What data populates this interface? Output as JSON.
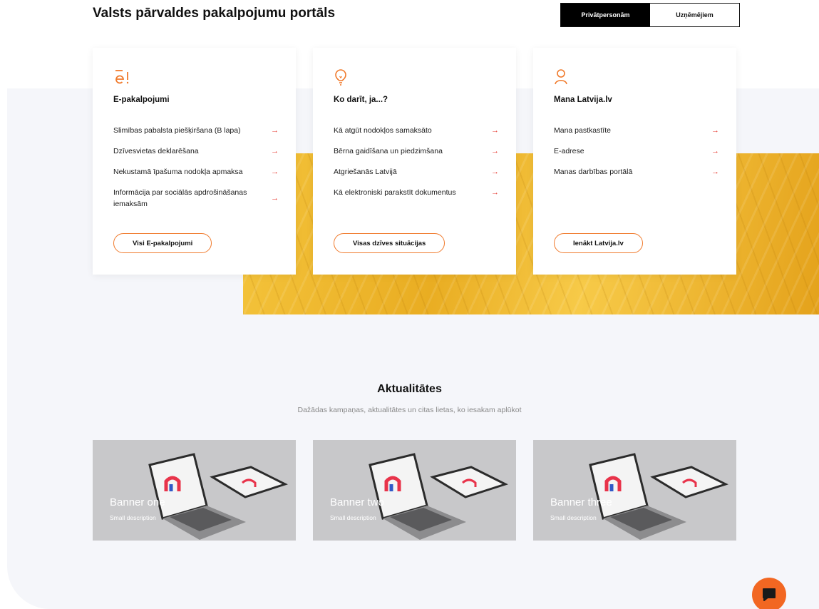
{
  "header": {
    "title": "Valsts pārvaldes pakalpojumu portāls",
    "audience_tabs": [
      {
        "label": "Privātpersonām",
        "active": true
      },
      {
        "label": "Uzņēmējiem",
        "active": false
      }
    ]
  },
  "cards": [
    {
      "icon": "e-service-icon",
      "title": "E-pakalpojumi",
      "links": [
        "Slimības pabalsta piešķiršana (B lapa)",
        "Dzīvesvietas deklarēšana",
        "Nekustamā īpašuma nodokļa apmaksa",
        "Informācija par sociālās apdrošināšanas iemaksām"
      ],
      "button": "Visi E-pakalpojumi"
    },
    {
      "icon": "lightbulb-icon",
      "title": "Ko darīt, ja...?",
      "links": [
        "Kā atgūt nodokļos samaksāto",
        "Bērna gaidīšana un piedzimšana",
        "Atgriešanās Latvijā",
        "Kā elektroniski parakstīt dokumentus"
      ],
      "button": "Visas dzīves situācijas"
    },
    {
      "icon": "user-icon",
      "title": "Mana Latvija.lv",
      "links": [
        "Mana pastkastīte",
        "E-adrese",
        "Manas darbības portālā"
      ],
      "button": "Ienākt Latvija.lv"
    }
  ],
  "news": {
    "title": "Aktualitātes",
    "subtitle": "Dažādas kampaņas, aktualitātes un citas lietas, ko iesakam aplūkot",
    "banners": [
      {
        "title": "Banner one",
        "description": "Small description"
      },
      {
        "title": "Banner two",
        "description": "Small description"
      },
      {
        "title": "Banner three",
        "description": "Small description"
      }
    ]
  },
  "colors": {
    "accent": "#f07a2c",
    "arrow": "#e5352c",
    "chat": "#f26722",
    "wheat": "#f0b52e"
  },
  "icons": {
    "link_arrow": "arrow-right-icon",
    "chat": "chat-bubble-icon"
  }
}
